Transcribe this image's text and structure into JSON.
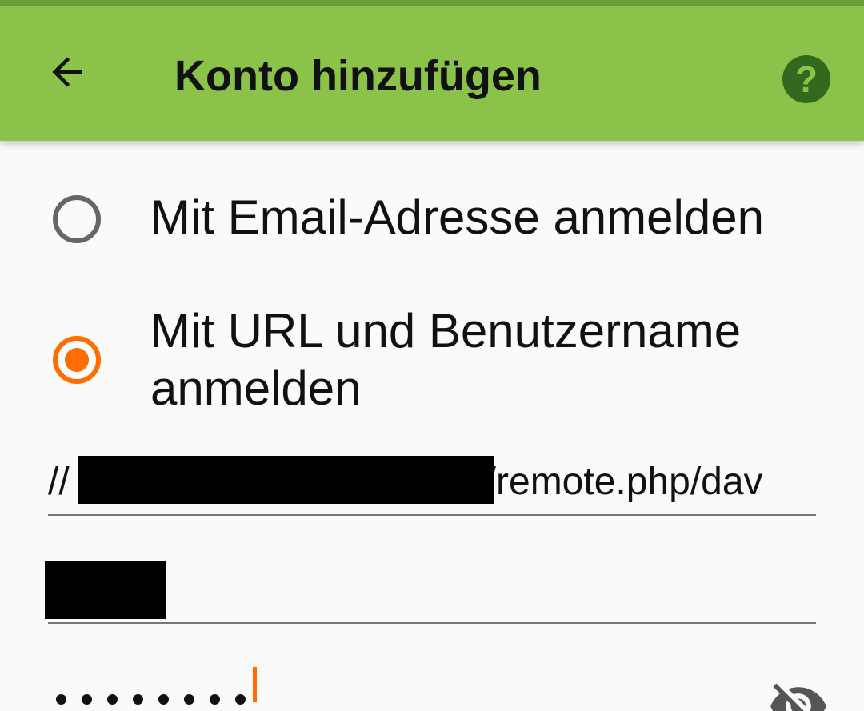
{
  "colors": {
    "toolbar_bg": "#8bc34a",
    "statusbar_edge": "#689f38",
    "help_icon_bg": "#33691e",
    "accent": "#ff6d00",
    "page_bg": "#fafafa"
  },
  "toolbar": {
    "back_icon": "arrow-back-icon",
    "title": "Konto hinzufügen",
    "help_icon": "help-icon",
    "help_glyph": "?"
  },
  "login_options": [
    {
      "label": "Mit Email-Adresse anmelden",
      "selected": false
    },
    {
      "label": "Mit URL und Benutzername anmelden",
      "selected": true
    }
  ],
  "form": {
    "base_url": {
      "prefix": "//",
      "suffix": "/remote.php/dav"
    },
    "username": {},
    "password": {
      "masked_length": 8,
      "visibility_icon": "visibility-off-icon"
    }
  }
}
